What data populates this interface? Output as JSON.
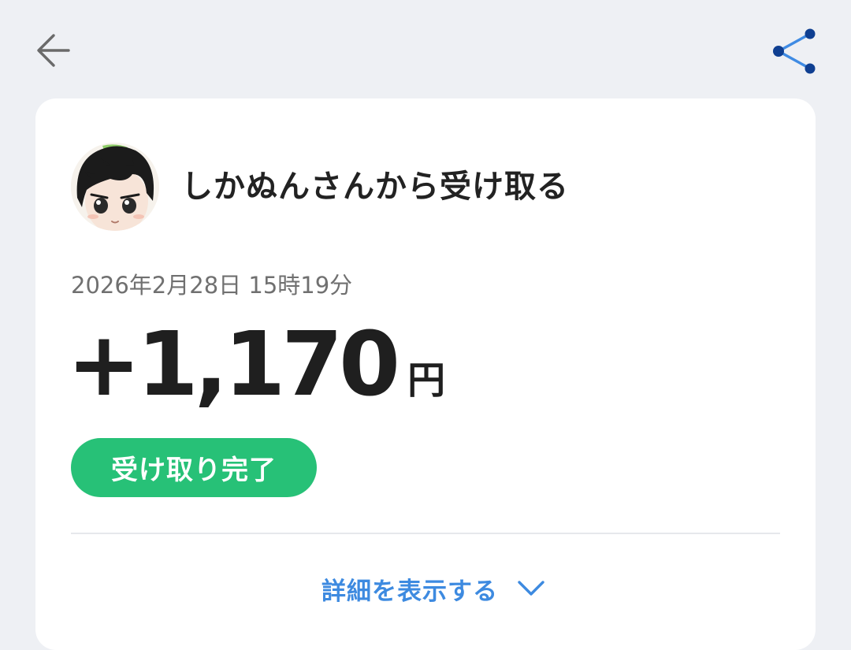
{
  "header": {
    "back_icon": "arrow-left-icon",
    "share_icon": "share-icon",
    "share_color": "#1a4fa8"
  },
  "transaction": {
    "sender_title": "しかぬんさんから受け取る",
    "datetime": "2026年2月28日 15時19分",
    "amount": "+1,170",
    "currency": "円",
    "status": "受け取り完了",
    "status_color": "#27c177"
  },
  "details": {
    "toggle_label": "詳細を表示する",
    "toggle_icon": "chevron-down-icon",
    "accent_color": "#3d8ae0"
  }
}
